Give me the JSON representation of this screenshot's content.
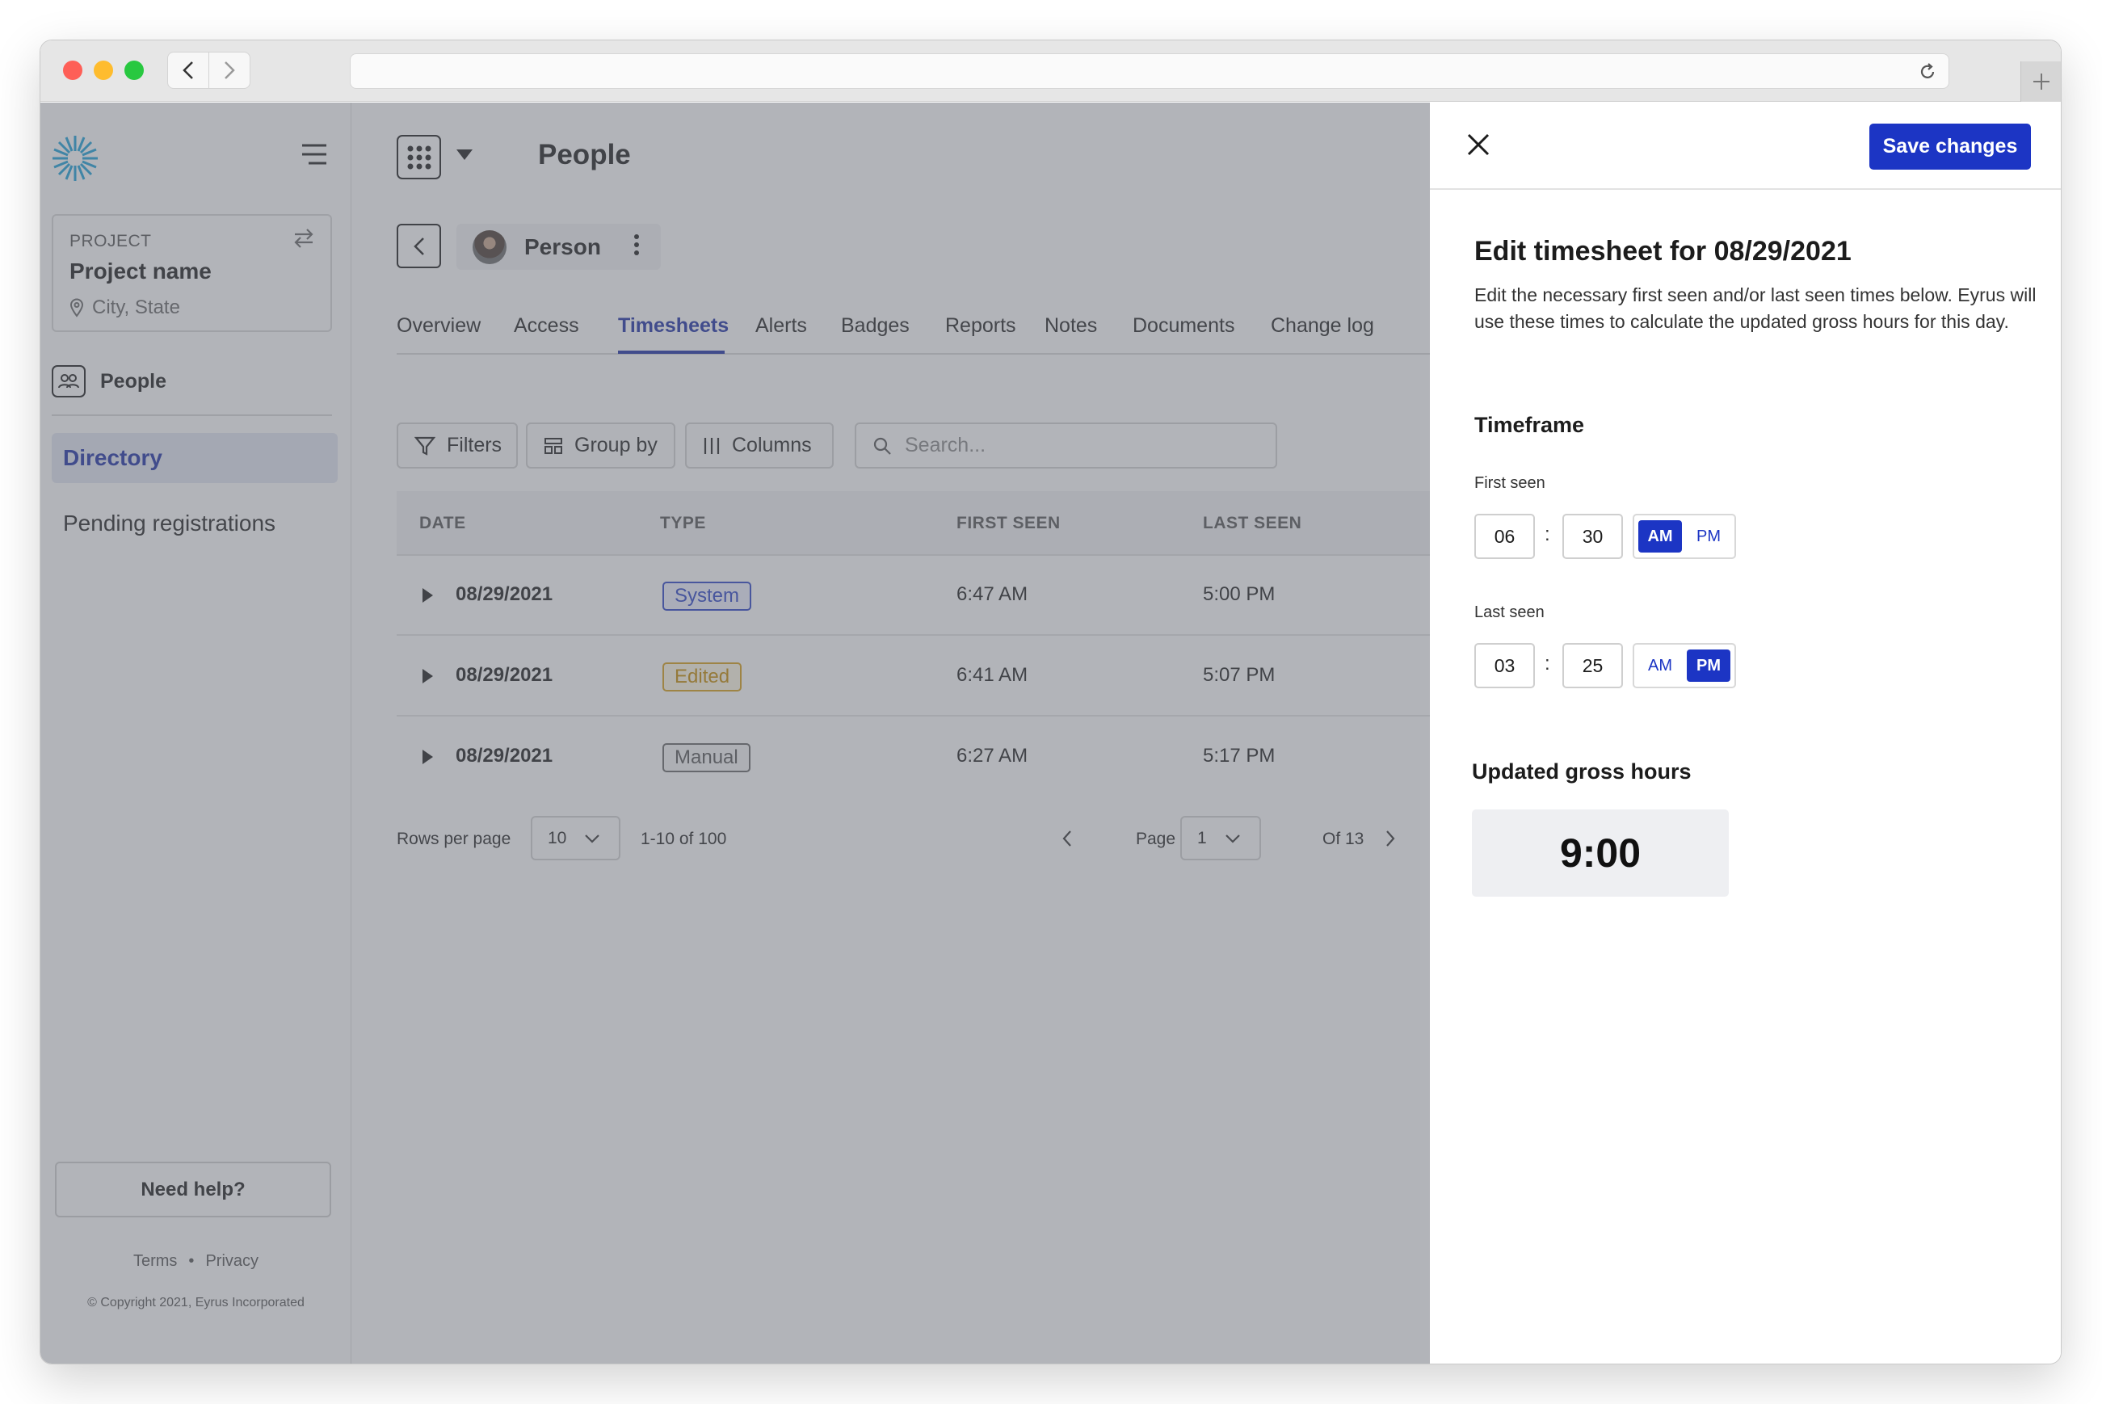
{
  "app": {
    "page_title": "People"
  },
  "project": {
    "label": "PROJECT",
    "name": "Project name",
    "location": "City, State"
  },
  "sidebar": {
    "section_label": "People",
    "items": [
      {
        "label": "Directory",
        "active": true
      },
      {
        "label": "Pending registrations",
        "active": false
      }
    ],
    "help_label": "Need help?",
    "footer": {
      "terms": "Terms",
      "privacy": "Privacy",
      "copyright": "© Copyright 2021, Eyrus Incorporated"
    }
  },
  "person": {
    "name": "Person"
  },
  "tabs": [
    {
      "label": "Overview"
    },
    {
      "label": "Access"
    },
    {
      "label": "Timesheets",
      "active": true
    },
    {
      "label": "Alerts"
    },
    {
      "label": "Badges"
    },
    {
      "label": "Reports"
    },
    {
      "label": "Notes"
    },
    {
      "label": "Documents"
    },
    {
      "label": "Change log"
    }
  ],
  "toolbar": {
    "filters": "Filters",
    "group_by": "Group by",
    "columns": "Columns",
    "search_placeholder": "Search..."
  },
  "table": {
    "headers": {
      "date": "DATE",
      "type": "TYPE",
      "first_seen": "FIRST SEEN",
      "last_seen": "LAST SEEN"
    },
    "rows": [
      {
        "date": "08/29/2021",
        "type": "System",
        "first_seen": "6:47 AM",
        "last_seen": "5:00 PM"
      },
      {
        "date": "08/29/2021",
        "type": "Edited",
        "first_seen": "6:41 AM",
        "last_seen": "5:07 PM"
      },
      {
        "date": "08/29/2021",
        "type": "Manual",
        "first_seen": "6:27 AM",
        "last_seen": "5:17 PM"
      }
    ]
  },
  "pagination": {
    "rows_per_page_label": "Rows per page",
    "rows_per_page": "10",
    "range": "1-10 of 100",
    "page_label": "Page",
    "page": "1",
    "of": "Of 13"
  },
  "panel": {
    "save_label": "Save changes",
    "title": "Edit timesheet for 08/29/2021",
    "description": "Edit the necessary first seen and/or last seen times below. Eyrus will use these times to calculate the updated gross hours for this day.",
    "timeframe_heading": "Timeframe",
    "first_seen": {
      "label": "First seen",
      "hour": "06",
      "minute": "30",
      "am": "AM",
      "pm": "PM",
      "selected": "AM"
    },
    "last_seen": {
      "label": "Last seen",
      "hour": "03",
      "minute": "25",
      "am": "AM",
      "pm": "PM",
      "selected": "PM"
    },
    "gross_heading": "Updated gross hours",
    "gross_value": "9:00"
  },
  "colors": {
    "accent": "#1c35c4",
    "system_badge": "#2b43c6",
    "edited_badge": "#d79e17",
    "manual_badge": "#666666"
  }
}
